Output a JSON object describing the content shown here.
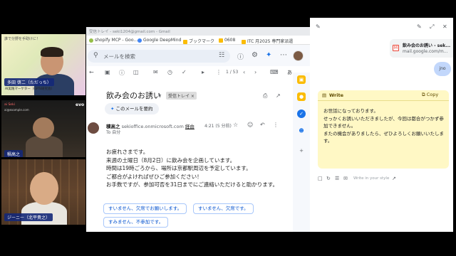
{
  "participants": [
    {
      "name": "多田 啓二（ただっち）",
      "subtitle": "AI実践マーケター（GPTs研究会）",
      "banner": "誰で分野を手助けに！"
    },
    {
      "name": "積高之",
      "overlay_top": "ai Seki",
      "overlay_sub": "ai@example.com",
      "corner": "evo"
    },
    {
      "name": "ジーニー（北平貴之）"
    }
  ],
  "browser": {
    "window_title": "受信トレイ - seki1204@gmail.com - Gmail",
    "bookmarks": [
      "shopify MCP - Goo...",
      "Google DeepMind",
      "ブックマーク",
      "0608",
      "ITC 月2025 専門家派遣"
    ],
    "search_placeholder": "メールを検索",
    "pagination": "1 / 53",
    "ime": "あ"
  },
  "email": {
    "subject": "飲み会のお誘い",
    "label": "受信トレイ ×",
    "summarize_label": "このメールを要約",
    "sender_name": "積高之",
    "sender_email": "sekioffice.onmicrosoft.com",
    "unsubscribe": "経由",
    "to": "To 自分",
    "date": "4:21 (5 分前)",
    "body_lines": [
      "お疲れさまです。",
      "来週の土曜日（8月2日）に飲み会を企画しています。",
      "時間は19時ごろから、場所は京都駅周辺を予定しています。",
      "ご都合がよければぜひご参加ください！",
      "お手数ですが、参加可否を31日までにご連絡いただけると助かります。"
    ],
    "smart_replies": [
      "すいません、欠席でお願いします。",
      "すいません、欠席です。",
      "すみません、不参加です。"
    ]
  },
  "panel": {
    "tab_title": "飲み会のお誘い - sek...",
    "tab_url": "mail.google.com/m...",
    "user_bubble": "jno",
    "write_label": "Write",
    "copy_label": "Copy",
    "write_lines": [
      "お世話になっております。",
      "せっかくお誘いいただきましたが、今回は都合がつかず参",
      "加できません。",
      "またの機会がありましたら、ぜひよろしくお願いいたしま",
      "す。"
    ],
    "input_placeholder": "Write in your style"
  },
  "colors": {
    "accent": "#0b57d0",
    "write_card": "#fff8c5",
    "nameplate": "#142878"
  }
}
